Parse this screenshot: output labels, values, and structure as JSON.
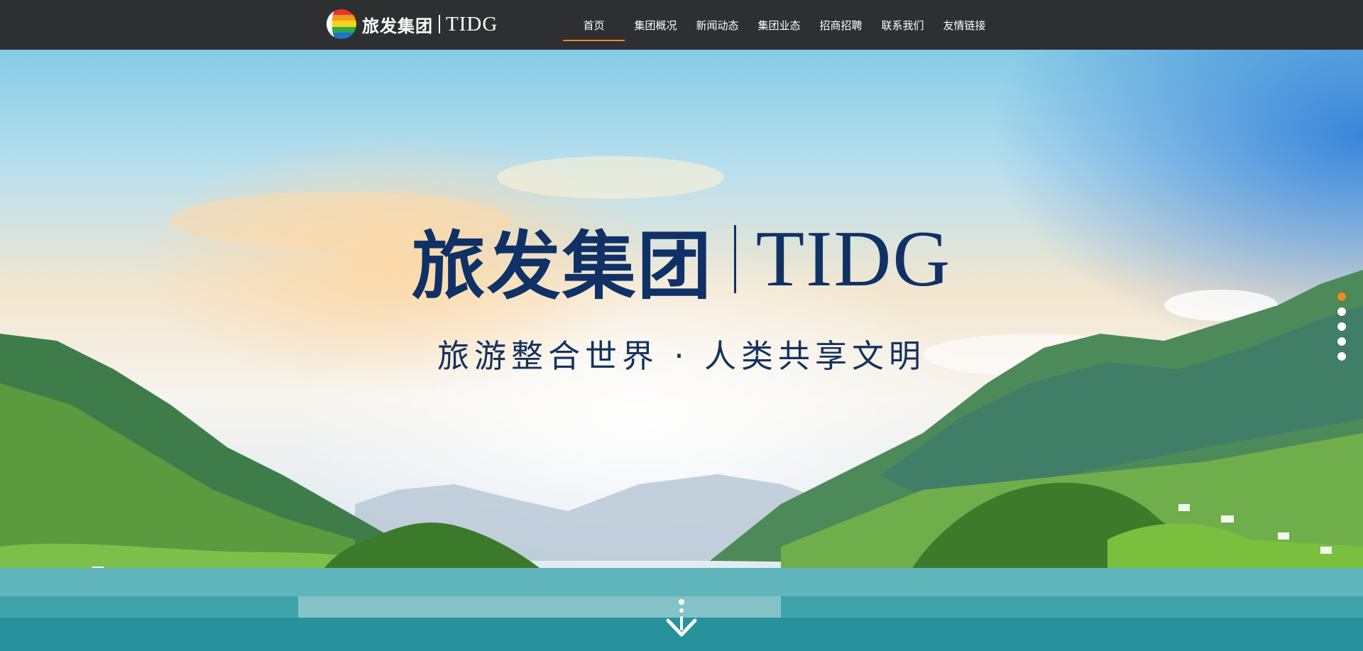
{
  "header": {
    "logo_cn": "旅发集团",
    "logo_en": "TIDG",
    "nav": [
      "首页",
      "集团概况",
      "新闻动态",
      "集团业态",
      "招商招聘",
      "联系我们",
      "友情链接"
    ],
    "active_index": 0
  },
  "hero": {
    "brand_cn": "旅发集团",
    "brand_en": "TIDG",
    "slogan": "旅游整合世界 · 人类共享文明",
    "slide_count": 5,
    "active_slide": 0
  },
  "icons": {
    "logo_mark": "rainbow-circle-logo-icon",
    "scroll": "scroll-down-arrow-icon"
  },
  "colors": {
    "topbar": "#2e2f31",
    "accent": "#f08a22",
    "brand_text": "#0f3166"
  }
}
